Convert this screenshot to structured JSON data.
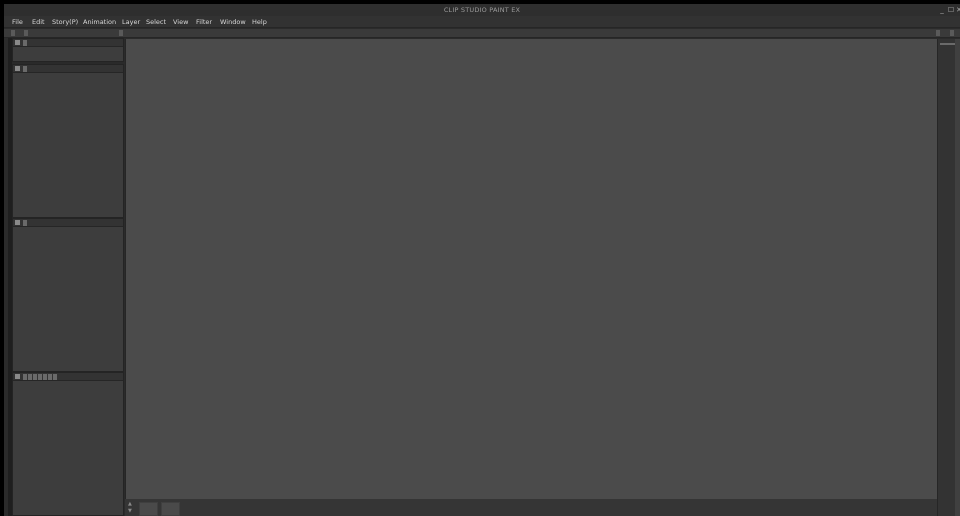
{
  "window": {
    "title": "CLIP STUDIO PAINT EX",
    "minimize_glyph": "_",
    "maximize_glyph": "☐",
    "close_glyph": "✕"
  },
  "menubar": {
    "items": [
      {
        "id": "file",
        "label": "File"
      },
      {
        "id": "edit",
        "label": "Edit"
      },
      {
        "id": "story",
        "label": "Story(P)"
      },
      {
        "id": "animation",
        "label": "Animation"
      },
      {
        "id": "layer",
        "label": "Layer"
      },
      {
        "id": "select",
        "label": "Select"
      },
      {
        "id": "view",
        "label": "View"
      },
      {
        "id": "filter",
        "label": "Filter"
      },
      {
        "id": "window",
        "label": "Window"
      },
      {
        "id": "help",
        "label": "Help"
      }
    ]
  },
  "colors": {
    "canvas": "#4b4b4b",
    "panel": "#3d3d3d",
    "chrome": "#2b2b2b"
  },
  "icons": {
    "command_bar_left": [
      "chevron-left-icon",
      "grip-icon"
    ],
    "command_bar_right": [
      "chevron-left-icon",
      "expand-icon"
    ],
    "panel_header": "panel-menu-icon"
  }
}
